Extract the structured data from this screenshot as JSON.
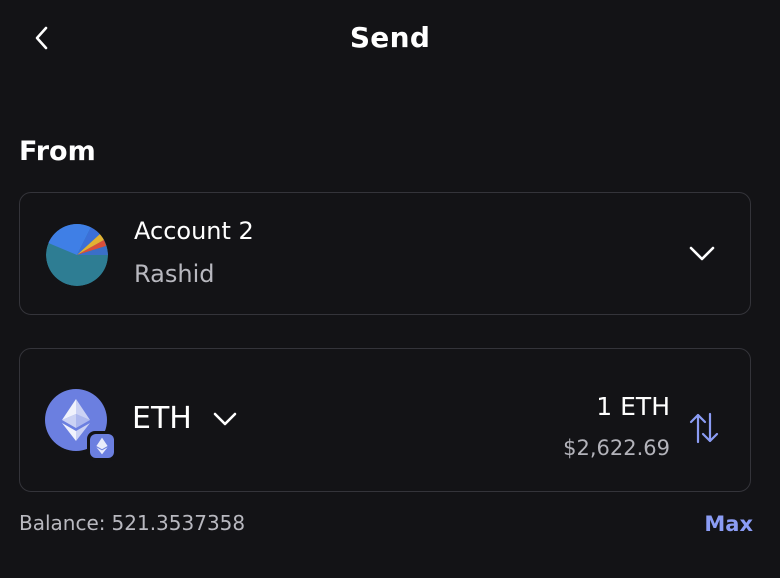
{
  "header": {
    "title": "Send",
    "back_icon": "chevron-left-icon"
  },
  "from": {
    "label": "From",
    "account": {
      "name": "Account 2",
      "subtitle": "Rashid",
      "dropdown_icon": "chevron-down-icon"
    }
  },
  "asset": {
    "symbol": "ETH",
    "logo_icon": "ethereum-icon",
    "network_badge_icon": "ethereum-network-icon",
    "dropdown_icon": "chevron-down-icon",
    "amount": "1 ETH",
    "fiat_value": "$2,622.69",
    "swap_icon": "swap-arrows-icon"
  },
  "balance": {
    "label": "Balance:",
    "value": "521.3537358"
  },
  "max_label": "Max",
  "colors": {
    "background": "#131316",
    "card_border": "#34343a",
    "accent": "#8b9cf4",
    "eth": "#6b7fe0",
    "muted_text": "#b8b8bf"
  }
}
